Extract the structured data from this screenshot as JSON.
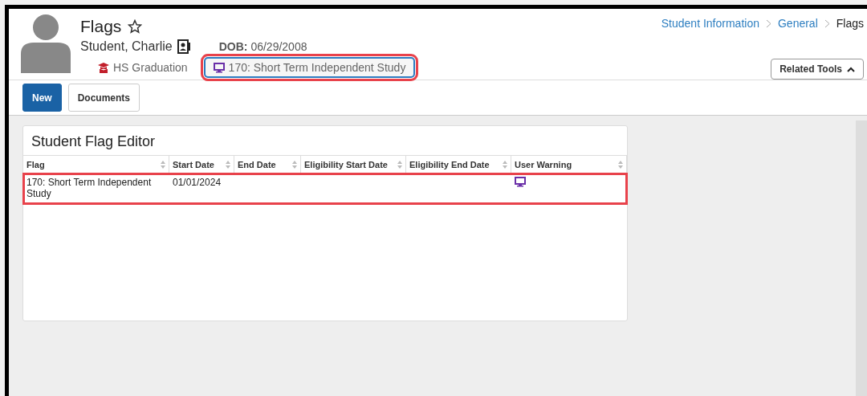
{
  "header": {
    "title": "Flags",
    "student_name": "Student, Charlie",
    "details": [
      {
        "label": "DOB:",
        "value": "06/29/2008"
      }
    ],
    "badges": [
      {
        "kind": "graduation",
        "label": "HS Graduation",
        "highlighted": false
      },
      {
        "kind": "flag",
        "label": "170: Short Term Independent Study",
        "highlighted": true
      }
    ]
  },
  "breadcrumb": [
    {
      "label": "Student Information",
      "current": false
    },
    {
      "label": "General",
      "current": false
    },
    {
      "label": "Flags",
      "current": true
    }
  ],
  "related_tools": {
    "label": "Related Tools",
    "expanded": true
  },
  "toolbar": [
    {
      "label": "New",
      "primary": true
    },
    {
      "label": "Documents",
      "primary": false
    }
  ],
  "editor": {
    "title": "Student Flag Editor",
    "columns": [
      "Flag",
      "Start Date",
      "End Date",
      "Eligibility Start Date",
      "Eligibility End Date",
      "User Warning"
    ],
    "rows": [
      {
        "flag": "170: Short Term Independent Study",
        "start_date": "01/01/2024",
        "end_date": "",
        "elig_start": "",
        "elig_end": "",
        "user_warning": true,
        "highlighted": true
      }
    ]
  }
}
